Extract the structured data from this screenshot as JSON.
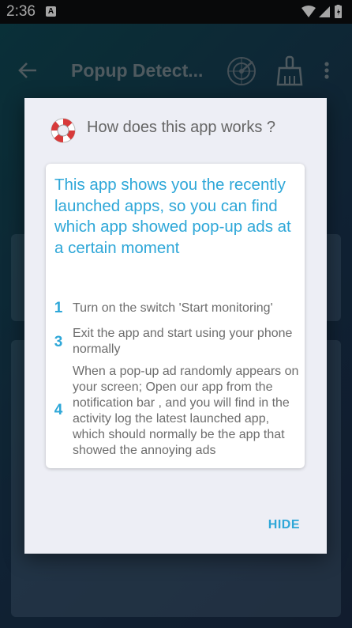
{
  "status_bar": {
    "time": "2:36",
    "notification_icon": "A"
  },
  "toolbar": {
    "title": "Popup Detect..."
  },
  "dialog": {
    "title": "How does this app works ?",
    "headline": "This app shows you the recently launched apps, so you can find which app showed pop-up ads at a certain moment",
    "steps": [
      {
        "number": "1",
        "text": "Turn on the switch 'Start monitoring'"
      },
      {
        "number": "3",
        "text": "Exit the app and start using your phone normally"
      },
      {
        "number": "4",
        "text": "When a pop-up ad randomly appears on your screen; Open our app from the notification bar , and you will find in the activity log the latest launched app, which should normally be the app that showed the annoying ads"
      }
    ],
    "hide_label": "HIDE"
  },
  "colors": {
    "accent": "#2ea7d8",
    "dialog_bg": "#edeef5",
    "app_bg": "#1a3550"
  }
}
